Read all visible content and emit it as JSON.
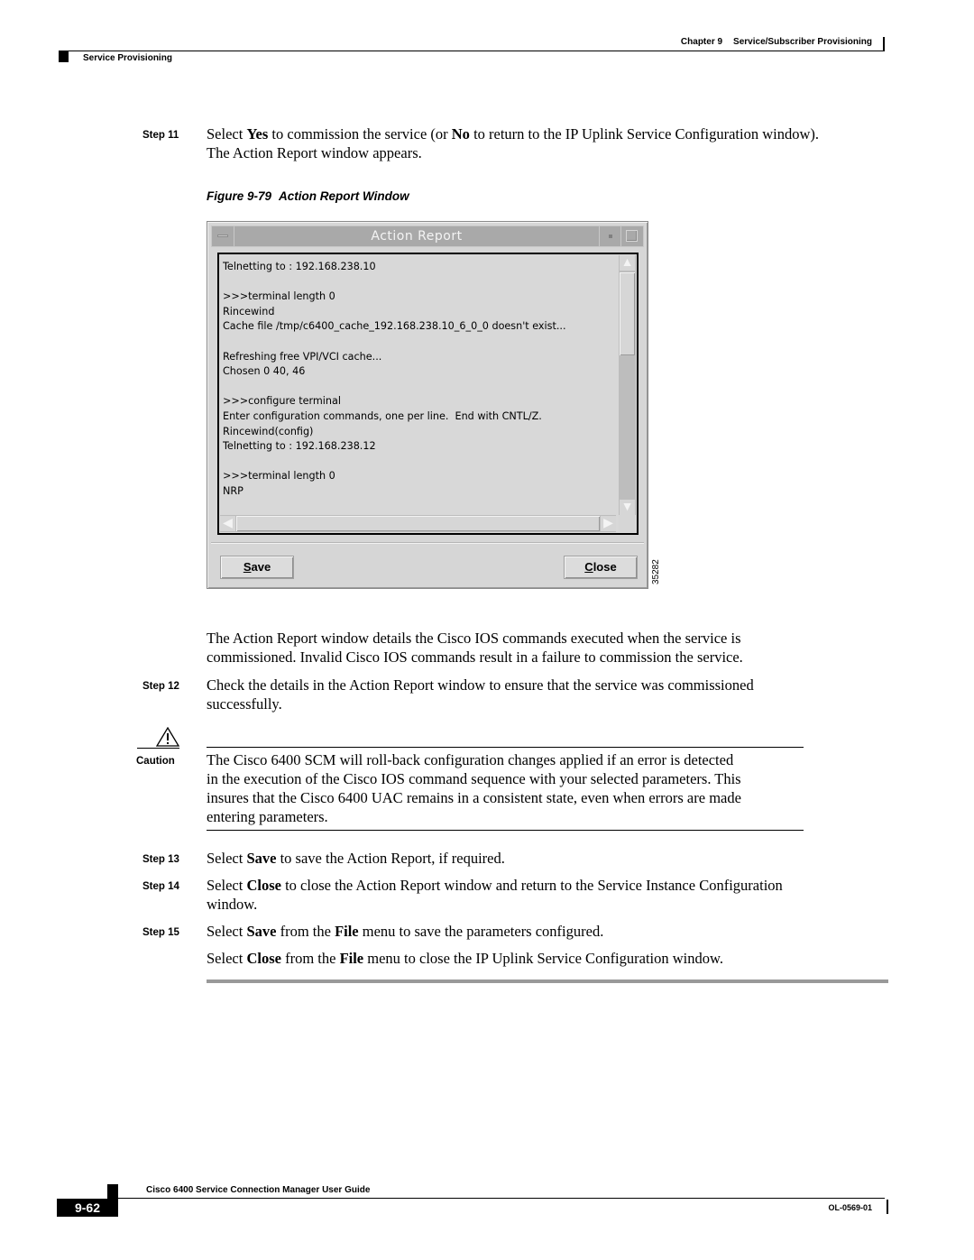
{
  "header": {
    "chapter": "Chapter 9",
    "chapter_title": "Service/Subscriber Provisioning",
    "section": "Service Provisioning"
  },
  "step11": {
    "label": "Step 11",
    "t1": "Select ",
    "b1": "Yes",
    "t2": " to commission the service (or ",
    "b2": "No",
    "t3": " to return to the IP Uplink Service Configuration window).",
    "line2": "The Action Report window appears."
  },
  "figure": {
    "number": "Figure 9-79",
    "title": "Action Report Window",
    "id": "35282"
  },
  "window": {
    "title": "Action Report",
    "report_lines": [
      "Telnetting to : 192.168.238.10",
      "",
      ">>>terminal length 0",
      "Rincewind",
      "Cache file /tmp/c6400_cache_192.168.238.10_6_0_0 doesn't exist...",
      "",
      "Refreshing free VPI/VCI cache...",
      "Chosen 0 40, 46",
      "",
      ">>>configure terminal",
      "Enter configuration commands, one per line.  End with CNTL/Z.",
      "Rincewind(config)",
      "Telnetting to : 192.168.238.12",
      "",
      ">>>terminal length 0",
      "NRP"
    ],
    "save_button": {
      "mnemonic": "S",
      "rest": "ave"
    },
    "close_button": {
      "mnemonic": "C",
      "rest": "lose"
    },
    "icons": {
      "window_menu": "window-menu-icon",
      "minimize": "minimize-icon",
      "maximize": "maximize-icon",
      "scroll_up": "arrow-up-icon",
      "scroll_down": "arrow-down-icon",
      "scroll_left": "arrow-left-icon",
      "scroll_right": "arrow-right-icon"
    }
  },
  "para_after_figure": {
    "line1": "The Action Report window details the Cisco IOS commands executed when the service is",
    "line2": "commissioned. Invalid Cisco IOS commands result in a failure to commission the service."
  },
  "step12": {
    "label": "Step 12",
    "line1": "Check the details in the Action Report window to ensure that the service was commissioned",
    "line2": "successfully."
  },
  "caution": {
    "label": "Caution",
    "icon": "warning-triangle-icon",
    "lines": [
      "The Cisco 6400 SCM will roll-back configuration changes applied if an error is detected",
      "in the execution of the Cisco IOS command sequence with your selected parameters. This",
      "insures that the Cisco 6400 UAC remains in a consistent state, even when errors are made",
      "entering parameters."
    ]
  },
  "step13": {
    "label": "Step 13",
    "t1": "Select ",
    "b1": "Save",
    "t2": " to save the Action Report, if required."
  },
  "step14": {
    "label": "Step 14",
    "t1": "Select ",
    "b1": "Close",
    "t2": " to close the Action Report window and return to the Service Instance Configuration",
    "line2": "window."
  },
  "step15": {
    "label": "Step 15",
    "t1": "Select ",
    "b1": "Save",
    "t2": " from the ",
    "b2": "File",
    "t3": " menu to save the parameters configured.",
    "p2_t1": "Select ",
    "p2_b1": "Close",
    "p2_t2": " from the ",
    "p2_b2": "File",
    "p2_t3": " menu to close the IP Uplink Service Configuration window."
  },
  "footer": {
    "guide_title": "Cisco 6400 Service Connection Manager User Guide",
    "page_number": "9-62",
    "doc_number": "OL-0569-01"
  }
}
